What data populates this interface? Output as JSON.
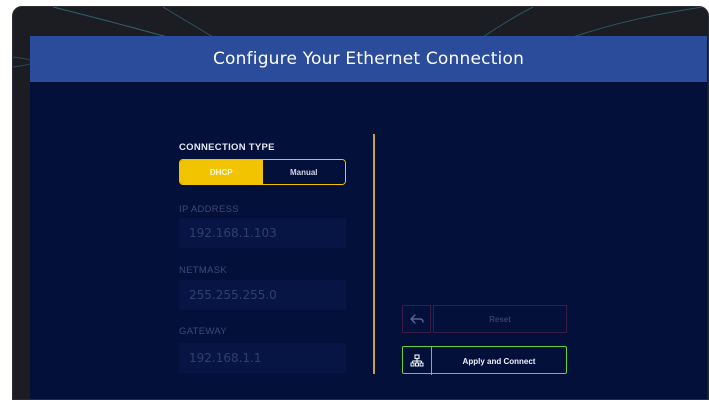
{
  "header": {
    "title": "Configure Your Ethernet Connection"
  },
  "connection_type": {
    "label": "CONNECTION TYPE",
    "options": [
      "DHCP",
      "Manual"
    ],
    "selected": "DHCP"
  },
  "ip_address": {
    "label": "IP ADDRESS",
    "value": "192.168.1.103"
  },
  "netmask": {
    "label": "NETMASK",
    "value": "255.255.255.0"
  },
  "gateway": {
    "label": "GATEWAY",
    "value": "192.168.1.1"
  },
  "buttons": {
    "reset_label": "Reset",
    "reset_icon": "undo-arrow-icon",
    "apply_label": "Apply and Connect",
    "apply_icon": "network-icon"
  },
  "colors": {
    "background": "#03103a",
    "header": "#2a4c9a",
    "accent_yellow": "#f2c400",
    "accent_green": "#5fd33b",
    "divider": "#c8a23a"
  }
}
